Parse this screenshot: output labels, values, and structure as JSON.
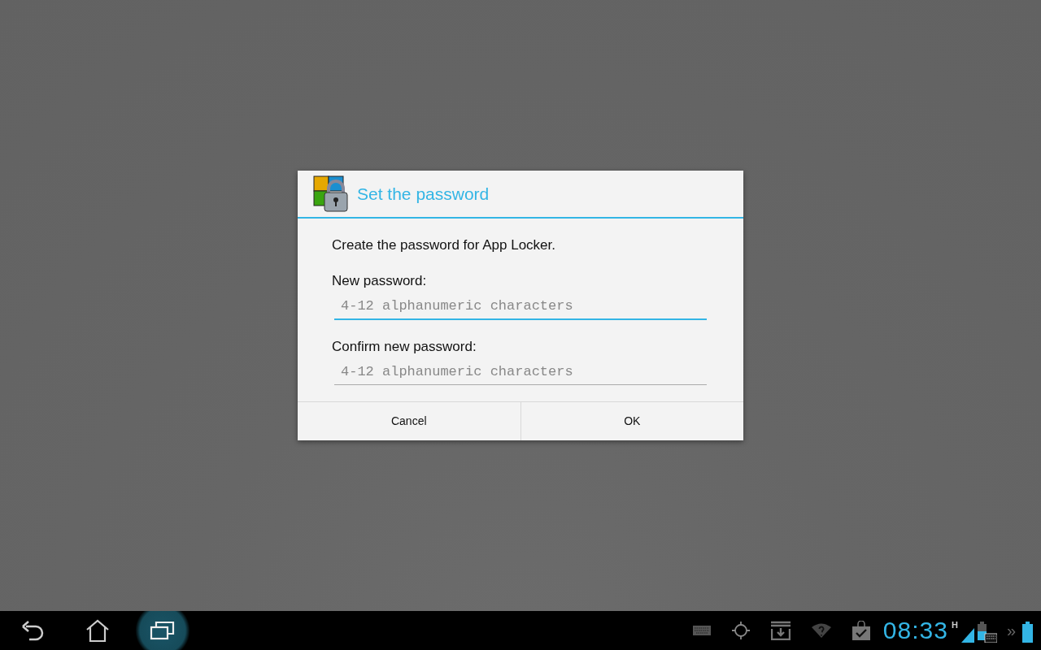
{
  "dialog": {
    "title": "Set the password",
    "message": "Create the password for App Locker.",
    "fields": [
      {
        "label": "New password:",
        "placeholder": "4-12 alphanumeric characters",
        "focused": true
      },
      {
        "label": "Confirm new password:",
        "placeholder": "4-12 alphanumeric characters",
        "focused": false
      }
    ],
    "buttons": [
      "Cancel",
      "OK"
    ]
  },
  "system_bar": {
    "clock": "08:33",
    "network_type": "H",
    "overflow": "»"
  }
}
